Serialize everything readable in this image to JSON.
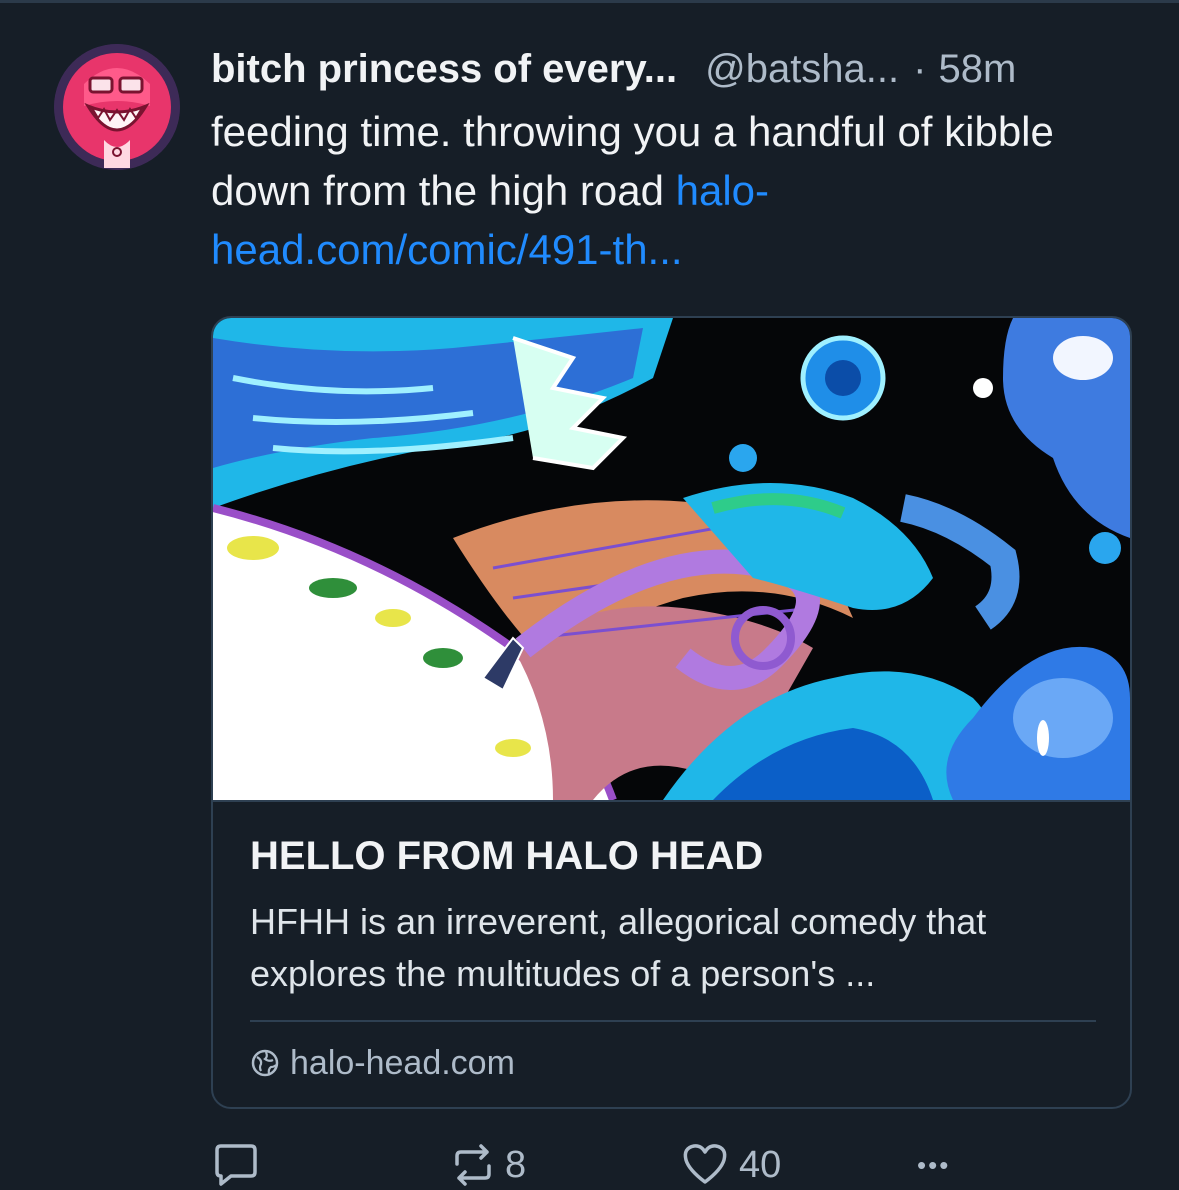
{
  "post": {
    "author_name": "bitch princess of every...",
    "handle": "@batsha...",
    "separator": "·",
    "time": "58m",
    "text": "feeding time. throwing you a handful of kibble down from the high road ",
    "link_text": "halo-head.com/comic/491-th...",
    "card": {
      "title": "HELLO FROM HALO HEAD",
      "description": "HFHH is an irreverent, allegorical comedy that explores the multitudes of a person's ...",
      "domain": "halo-head.com"
    },
    "actions": {
      "reposts": "8",
      "likes": "40",
      "more": "•••"
    }
  },
  "colors": {
    "background": "#161e27",
    "link": "#208bfe",
    "muted": "#aebbc9",
    "border": "#2e4052"
  },
  "icons": [
    "avatar-image",
    "globe-icon",
    "reply-icon",
    "repost-icon",
    "heart-icon",
    "more-icon"
  ]
}
